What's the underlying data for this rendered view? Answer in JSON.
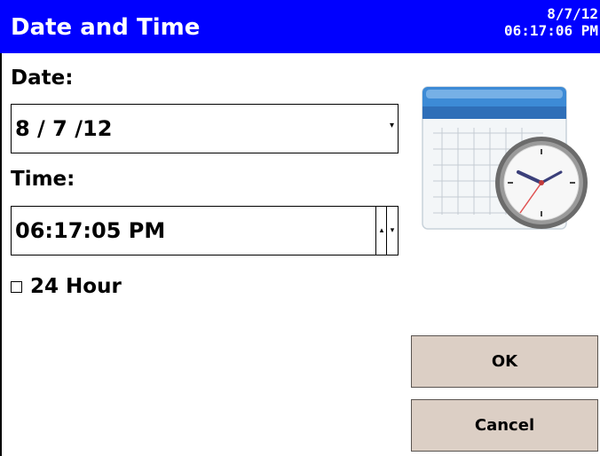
{
  "window": {
    "title": "Date and Time",
    "clock_date": "8/7/12",
    "clock_time": "06:17:06 PM",
    "title_bar_color": "#0000ff"
  },
  "date": {
    "label": "Date:",
    "value": "8 / 7 /12",
    "dropdown_icon": "dropdown-arrow"
  },
  "time": {
    "label": "Time:",
    "value": "06:17:05 PM",
    "spinner_icons": [
      "up-arrow",
      "down-arrow"
    ]
  },
  "hour24": {
    "label": "24 Hour",
    "checked": false
  },
  "buttons": {
    "ok": "OK",
    "cancel": "Cancel",
    "face_color": "#dccfc5"
  },
  "illustration": {
    "icon": "calendar-clock-icon"
  }
}
